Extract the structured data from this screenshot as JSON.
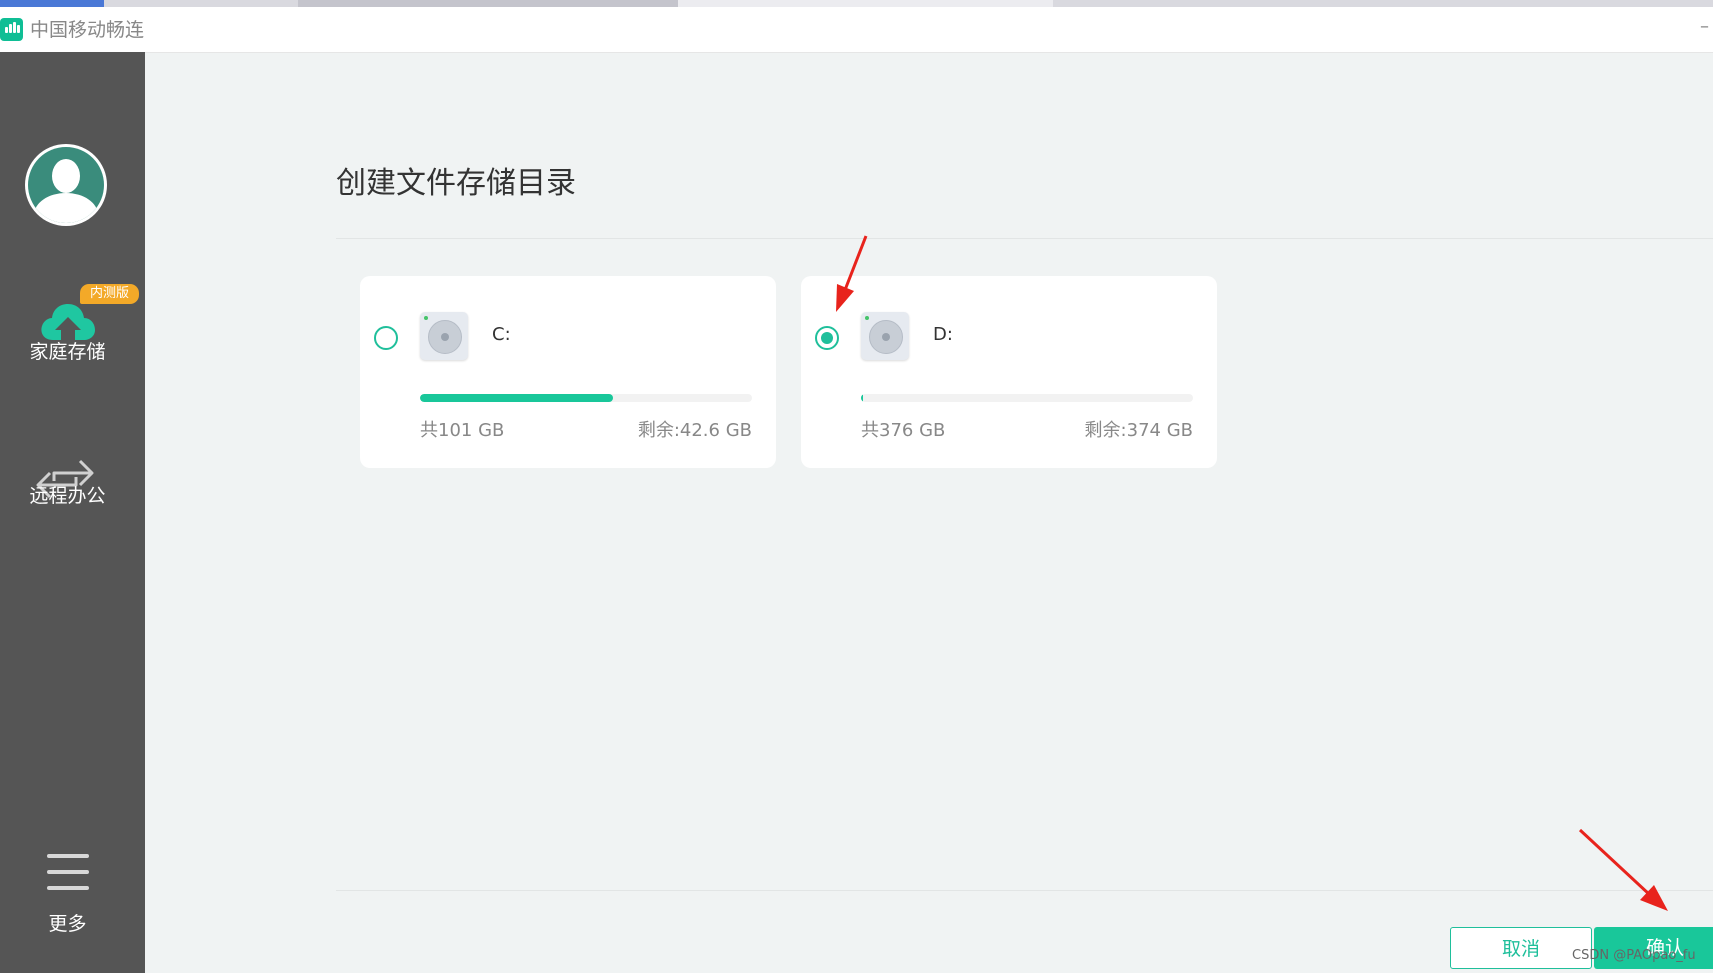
{
  "window": {
    "title": "中国移动畅连",
    "minimize_glyph": "–"
  },
  "sidebar": {
    "avatar_icon": "user-avatar-icon",
    "items": [
      {
        "label": "家庭存储",
        "badge": "内测版",
        "icon": "cloud-upload-icon",
        "active": true
      },
      {
        "label": "远程办公",
        "icon": "transfer-arrows-icon",
        "active": false
      }
    ],
    "more": {
      "label": "更多",
      "icon": "menu-icon"
    }
  },
  "main": {
    "title": "创建文件存储目录",
    "drives": [
      {
        "name": "C:",
        "total": "共101 GB",
        "free": "剩余:42.6 GB",
        "used_fraction": 0.58,
        "selected": false
      },
      {
        "name": "D:",
        "total": "共376 GB",
        "free": "剩余:374 GB",
        "used_fraction": 0.005,
        "selected": true
      }
    ]
  },
  "footer": {
    "cancel_label": "取消",
    "confirm_label": "确认"
  },
  "watermark": "CSDN @PAOpao_fu",
  "colors": {
    "accent": "#19c79a",
    "sidebar_bg": "#555555",
    "badge": "#f3a928",
    "arrow": "#e8231c"
  }
}
